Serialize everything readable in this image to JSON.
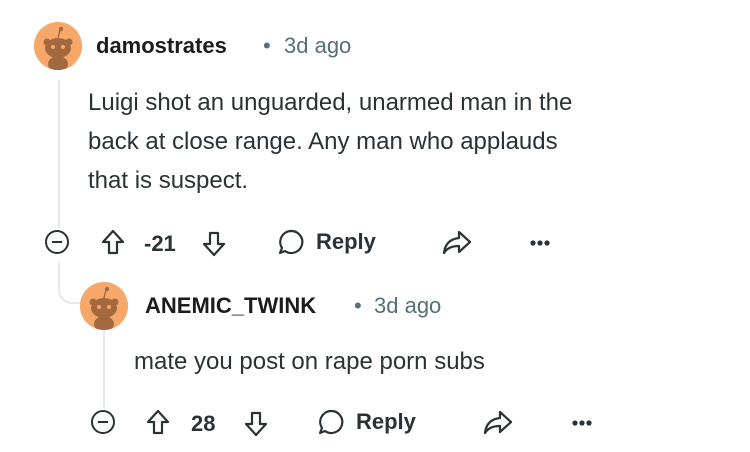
{
  "comments": [
    {
      "username": "damostrates",
      "separator": "•",
      "time": "3d ago",
      "body_lines": [
        "Luigi shot an unguarded, unarmed man in the",
        "back at close range. Any man who applauds",
        "that is suspect."
      ],
      "score": "-21",
      "reply_label": "Reply"
    },
    {
      "username": "ANEMIC_TWINK",
      "separator": "•",
      "time": "3d ago",
      "body_lines": [
        "mate you post on rape porn subs"
      ],
      "score": "28",
      "reply_label": "Reply"
    }
  ],
  "icons": {
    "avatar": "snoo-avatar-icon",
    "collapse": "minus-circle-icon",
    "upvote": "upvote-arrow-icon",
    "downvote": "downvote-arrow-icon",
    "reply": "speech-bubble-icon",
    "share": "share-arrow-icon",
    "more": "ellipsis-icon"
  },
  "colors": {
    "avatar_bg": "#f6a86a",
    "text": "#1c1c1c",
    "meta": "#576f76",
    "thread_line": "#e5e8ea"
  }
}
